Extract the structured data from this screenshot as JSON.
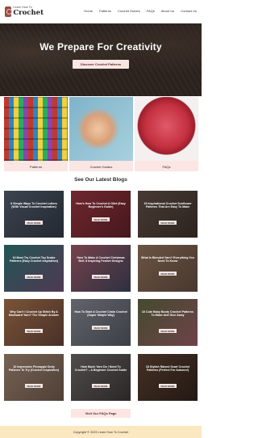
{
  "header": {
    "logo_small": "Learn How To",
    "logo_big": "Crochet",
    "nav": [
      "Home",
      "Patterns",
      "Crochet Guides",
      "FAQs",
      "About Us",
      "Contact Us"
    ]
  },
  "hero": {
    "title": "We Prepare For Creativity",
    "button": "Discover Crochet Patterns"
  },
  "categories": [
    {
      "label": "Patterns",
      "icon": "granny-squares-image"
    },
    {
      "label": "Crochet Guides",
      "icon": "crochet-hands-image"
    },
    {
      "label": "FAQs",
      "icon": "yarn-ball-image"
    }
  ],
  "section_title": "See Our Latest Blogs",
  "blogs": [
    {
      "title": "8 Simple Ways To Crochet Letters (With Visual Crochet Inspiration)",
      "button": "READ MORE"
    },
    {
      "title": "How's How To Crochet A Gilet (Easy Beginner's Guide)",
      "button": "READ MORE"
    },
    {
      "title": "15 Inspirational Crochet Sunflower Patterns That Are Easy To Make",
      "button": "READ MORE"
    },
    {
      "title": "10 Must Try Crochet Toy Snake Patterns (Easy Crochet Inspiration)",
      "button": "READ MORE"
    },
    {
      "title": "How To Make A Crochet Christmas Bell: 8 Inspiring Festive Designs",
      "button": "READ MORE"
    },
    {
      "title": "What Is Blended Yarn? Everything You Need To Know",
      "button": "READ MORE"
    },
    {
      "title": "Why Can't I Crochet Up Stitch By A Backward Yarn? The Simple Answer",
      "button": "READ MORE"
    },
    {
      "title": "How To Start A Crochet Chain Crochet (Super Simple Way)",
      "button": "READ MORE"
    },
    {
      "title": "10 Cute Baby Booty Crochet Patterns To Make And Give Away",
      "button": "READ MORE"
    },
    {
      "title": "10 Impressive Pineapple Doily Patterns To Try (Crochet Inspiration)",
      "button": "READ MORE"
    },
    {
      "title": "How Much Yarn Do I Need To Crochet? – A Beginner Crochet Guide",
      "button": "READ MORE"
    },
    {
      "title": "18 Stylish Raised Scarf Crochet Patterns (Perfect For Autumn!)",
      "button": "READ MORE"
    }
  ],
  "faq_button": "Visit Our FAQs Page",
  "footer": "Copyright © 2023 Learn How To Crochet"
}
